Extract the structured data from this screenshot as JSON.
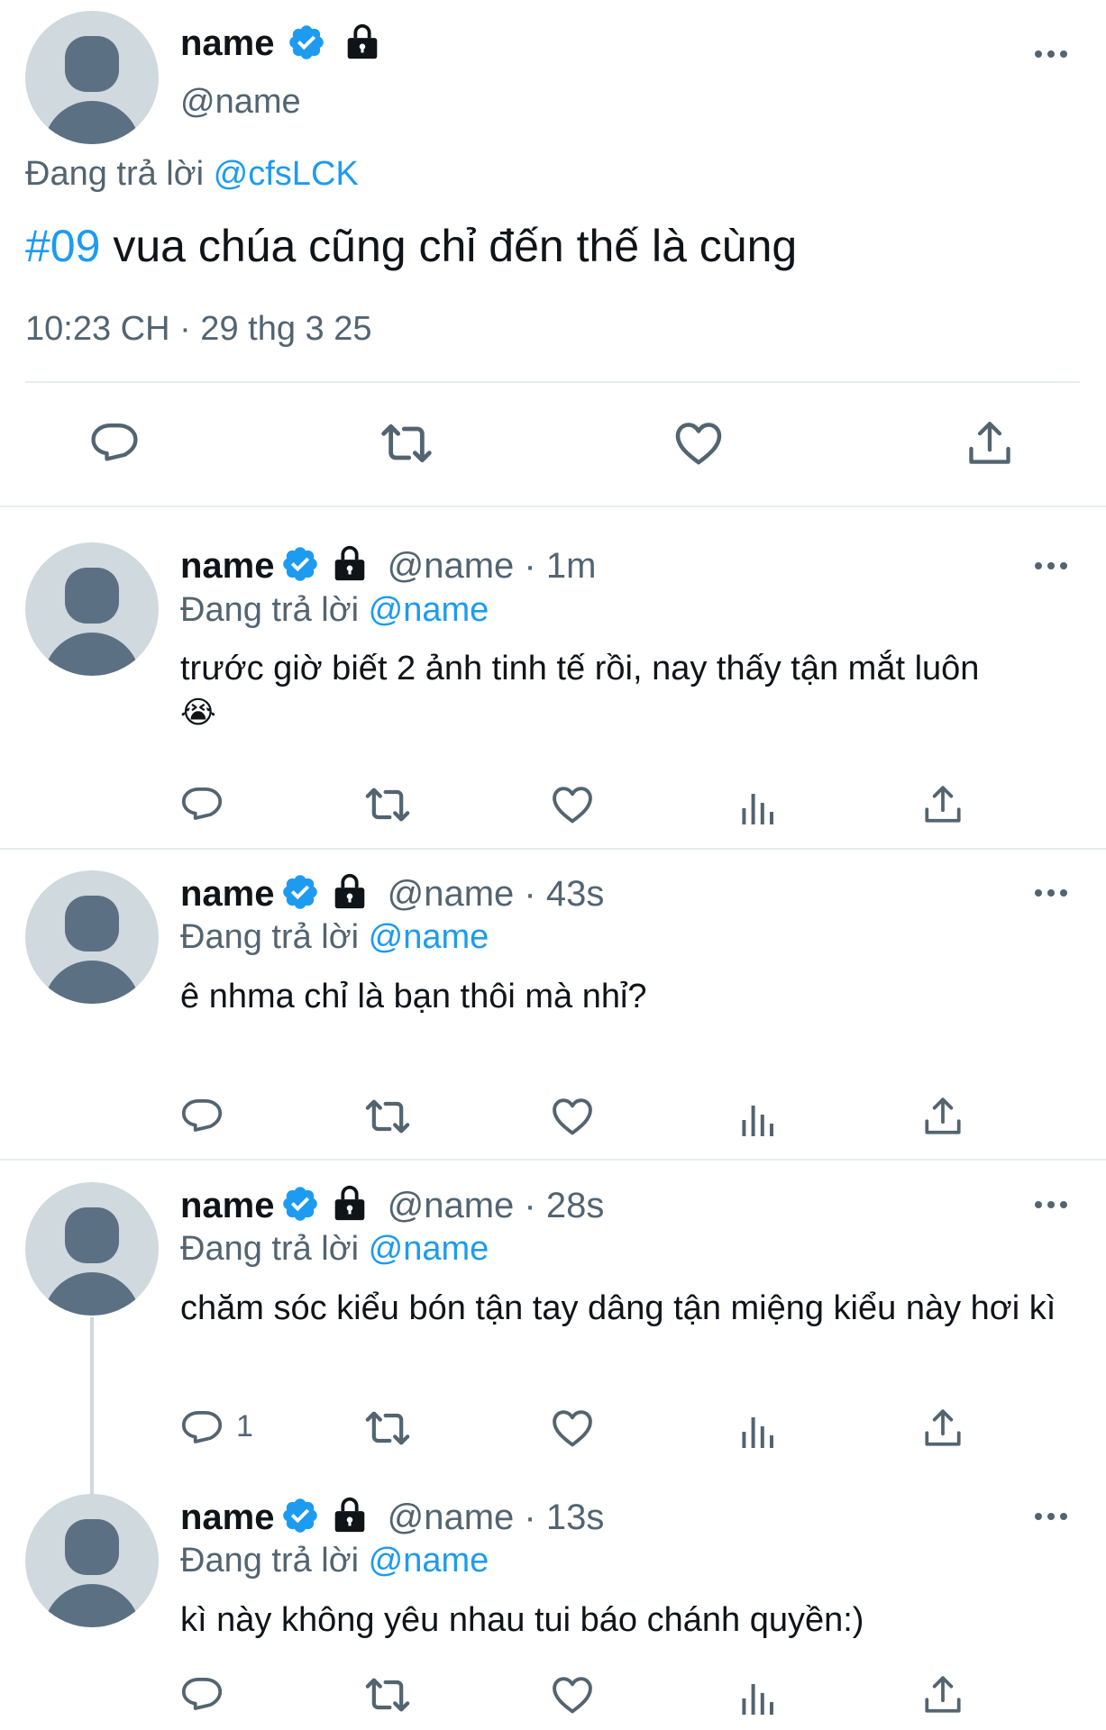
{
  "main_tweet": {
    "display_name": "name",
    "handle": "@name",
    "replying_to_prefix": "Đang trả lời",
    "replying_to_handle": "@cfsLCK",
    "hashtag": "#09",
    "text": " vua chúa cũng chỉ đến thế là cùng",
    "timestamp": "10:23 CH · 29 thg 3 25"
  },
  "replies": [
    {
      "display_name": "name",
      "handle": "@name",
      "time": "· 1m",
      "replying_to_prefix": "Đang trả lời",
      "replying_to_handle": "@name",
      "text": "trước giờ biết 2 ảnh tinh tế rồi, nay thấy tận mắt luôn",
      "emoji": "😭",
      "reply_count": ""
    },
    {
      "display_name": "name",
      "handle": "@name",
      "time": "· 43s",
      "replying_to_prefix": "Đang trả lời",
      "replying_to_handle": "@name",
      "text": "ê nhma chỉ là bạn thôi mà nhỉ?",
      "reply_count": ""
    },
    {
      "display_name": "name",
      "handle": "@name",
      "time": "· 28s",
      "replying_to_prefix": "Đang trả lời",
      "replying_to_handle": "@name",
      "text": "chăm sóc kiểu bón tận tay dâng tận miệng kiểu này hơi kì",
      "reply_count": "1"
    },
    {
      "display_name": "name",
      "handle": "@name",
      "time": "· 13s",
      "replying_to_prefix": "Đang trả lời",
      "replying_to_handle": "@name",
      "text": "kì này không yêu nhau tui báo chánh quyền:)",
      "reply_count": ""
    }
  ],
  "colors": {
    "accent": "#1d9bf0",
    "secondary_text": "#536471",
    "avatar_bg": "#cfd9de"
  }
}
